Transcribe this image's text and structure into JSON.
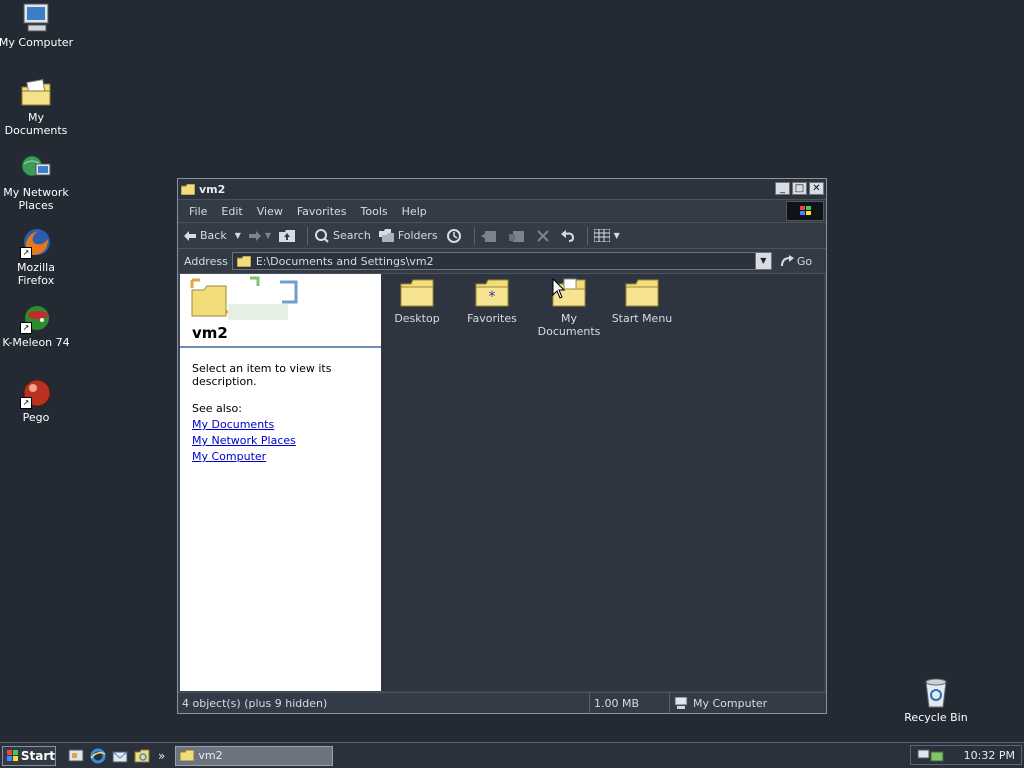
{
  "desktop": {
    "icons": [
      {
        "label": "My Computer"
      },
      {
        "label": "My Documents"
      },
      {
        "label": "My Network Places"
      },
      {
        "label": "Mozilla Firefox"
      },
      {
        "label": "K-Meleon 74"
      },
      {
        "label": "Pego"
      },
      {
        "label": "Recycle Bin"
      }
    ]
  },
  "window": {
    "title": "vm2",
    "menu": [
      "File",
      "Edit",
      "View",
      "Favorites",
      "Tools",
      "Help"
    ],
    "toolbar": {
      "back": "Back",
      "search": "Search",
      "folders": "Folders"
    },
    "address": {
      "label": "Address",
      "value": "E:\\Documents and Settings\\vm2",
      "go": "Go"
    },
    "left_pane": {
      "title": "vm2",
      "description": "Select an item to view its description.",
      "see_also": "See also:",
      "links": [
        "My Documents",
        "My Network Places",
        "My Computer"
      ]
    },
    "items": [
      {
        "label": "Desktop"
      },
      {
        "label": "Favorites"
      },
      {
        "label": "My Documents"
      },
      {
        "label": "Start Menu"
      }
    ],
    "status": {
      "objects": "4 object(s) (plus 9 hidden)",
      "size": "1.00 MB",
      "location": "My Computer"
    }
  },
  "taskbar": {
    "start": "Start",
    "task": "vm2",
    "clock": "10:32 PM",
    "overflow": "»"
  },
  "colors": {
    "desktop": "#232a33",
    "folder": "#f3dc7a",
    "link": "#0000cc"
  }
}
